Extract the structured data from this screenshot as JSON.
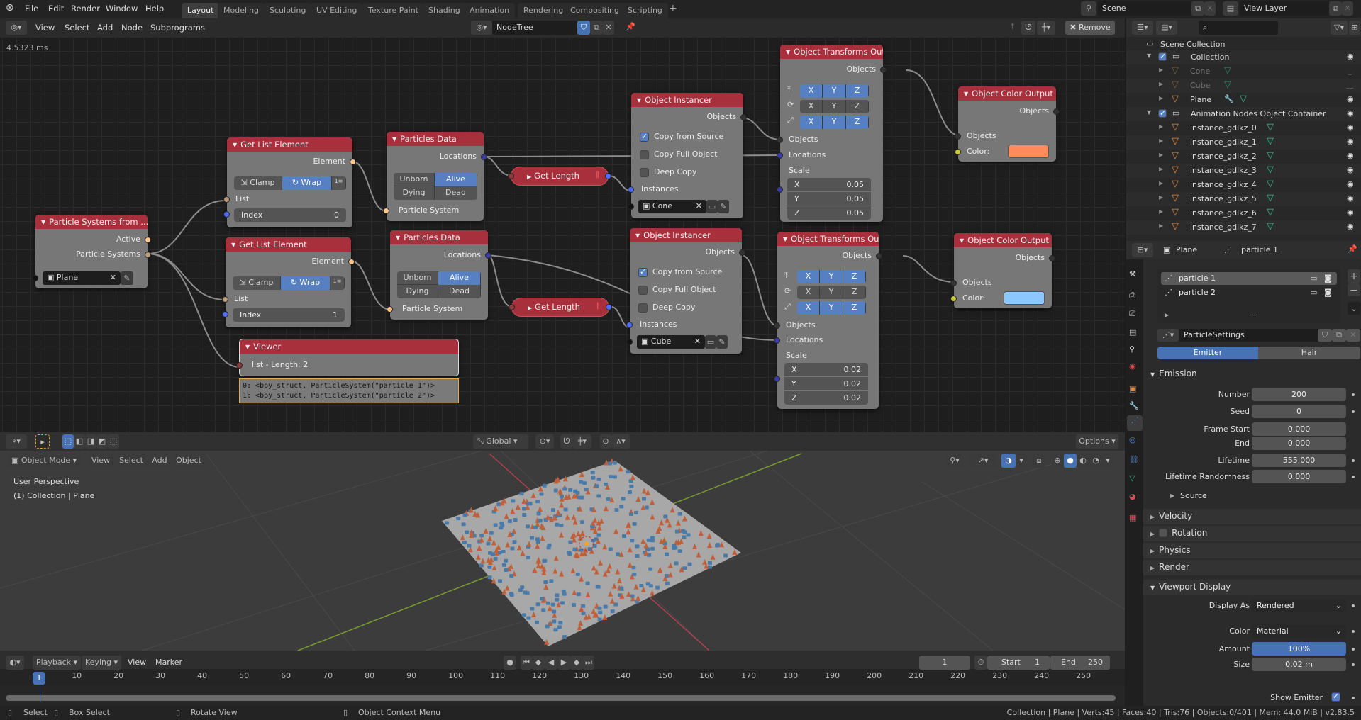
{
  "topbar": {
    "menus": [
      "File",
      "Edit",
      "Render",
      "Window",
      "Help"
    ],
    "workspaces": [
      "Layout",
      "Modeling",
      "Sculpting",
      "UV Editing",
      "Texture Paint",
      "Shading",
      "Animation",
      "Rendering",
      "Compositing",
      "Scripting"
    ],
    "active_workspace": "Layout",
    "scene": "Scene",
    "view_layer": "View Layer"
  },
  "node_editor": {
    "menus": [
      "View",
      "Select",
      "Add",
      "Node",
      "Subprograms"
    ],
    "tree_name": "NodeTree",
    "remove_label": "Remove",
    "timing": "4.5323 ms",
    "nodes": {
      "ps_from": {
        "title": "Particle Systems from ...",
        "out1": "Active",
        "out2": "Particle Systems",
        "object": "Plane"
      },
      "gle1": {
        "title": "Get List Element",
        "out": "Element",
        "clamp": "Clamp",
        "wrap": "Wrap",
        "in_list": "List",
        "index_label": "Index",
        "index": "0"
      },
      "gle2": {
        "title": "Get List Element",
        "out": "Element",
        "clamp": "Clamp",
        "wrap": "Wrap",
        "in_list": "List",
        "index_label": "Index",
        "index": "1"
      },
      "pd1": {
        "title": "Particles Data",
        "out": "Locations",
        "states": [
          "Unborn",
          "Alive",
          "Dying",
          "Dead"
        ],
        "active_state": "Alive",
        "in": "Particle System"
      },
      "pd2": {
        "title": "Particles Data",
        "out": "Locations",
        "states": [
          "Unborn",
          "Alive",
          "Dying",
          "Dead"
        ],
        "active_state": "Alive",
        "in": "Particle System"
      },
      "gl1": {
        "title": "Get Length"
      },
      "gl2": {
        "title": "Get Length"
      },
      "oi1": {
        "title": "Object Instancer",
        "out": "Objects",
        "copy_source": "Copy from Source",
        "copy_full": "Copy Full Object",
        "deep_copy": "Deep Copy",
        "copy_source_checked": true,
        "copy_full_checked": false,
        "deep_copy_checked": false,
        "instances": "Instances",
        "object": "Cone"
      },
      "oi2": {
        "title": "Object Instancer",
        "out": "Objects",
        "copy_source": "Copy from Source",
        "copy_full": "Copy Full Object",
        "deep_copy": "Deep Copy",
        "copy_source_checked": true,
        "copy_full_checked": false,
        "deep_copy_checked": false,
        "instances": "Instances",
        "object": "Cube"
      },
      "oto1": {
        "title": "Object Transforms Output",
        "out": "Objects",
        "axes": [
          "X",
          "Y",
          "Z"
        ],
        "in_objects": "Objects",
        "in_locations": "Locations",
        "scale_label": "Scale",
        "scale": {
          "X": "0.05",
          "Y": "0.05",
          "Z": "0.05"
        }
      },
      "oto2": {
        "title": "Object Transforms Output",
        "out": "Objects",
        "axes": [
          "X",
          "Y",
          "Z"
        ],
        "in_objects": "Objects",
        "in_locations": "Locations",
        "scale_label": "Scale",
        "scale": {
          "X": "0.02",
          "Y": "0.02",
          "Z": "0.02"
        }
      },
      "oco1": {
        "title": "Object Color Output",
        "out": "Objects",
        "in_objects": "Objects",
        "color_label": "Color:",
        "color": "#ff8a5c"
      },
      "oco2": {
        "title": "Object Color Output",
        "out": "Objects",
        "in_objects": "Objects",
        "color_label": "Color:",
        "color": "#8cc8ff"
      },
      "viewer": {
        "title": "Viewer",
        "text": "list - Length: 2",
        "lines": [
          "0: <bpy_struct, ParticleSystem(\"particle 1\")>",
          "1: <bpy_struct, ParticleSystem(\"particle 2\")>"
        ]
      }
    }
  },
  "viewport": {
    "mode": "Object Mode",
    "menus": [
      "View",
      "Select",
      "Add",
      "Object"
    ],
    "orientation": "Global",
    "options": "Options",
    "perspective": "User Perspective",
    "context": "(1) Collection | Plane"
  },
  "timeline": {
    "menus": [
      "Playback",
      "Keying",
      "View",
      "Marker"
    ],
    "current_frame": "1",
    "start_label": "Start",
    "start": "1",
    "end_label": "End",
    "end": "250",
    "ticks": [
      "10",
      "20",
      "30",
      "40",
      "50",
      "60",
      "70",
      "80",
      "90",
      "100",
      "110",
      "120",
      "130",
      "140",
      "150",
      "160",
      "170",
      "180",
      "190",
      "200",
      "210",
      "220",
      "230",
      "240",
      "250"
    ]
  },
  "statusbar": {
    "hints": [
      "Select",
      "Box Select",
      "Rotate View",
      "Object Context Menu"
    ],
    "stats": "Collection | Plane | Verts:45 | Faces:40 | Tris:76 | Objects:0/401 | Mem: 44.0 MiB | v2.83.5"
  },
  "outliner": {
    "root": "Scene Collection",
    "items": [
      {
        "label": "Collection",
        "type": "collection",
        "depth": 0,
        "visible": true
      },
      {
        "label": "Cone",
        "type": "object",
        "depth": 1,
        "visible": false,
        "dim": true
      },
      {
        "label": "Cube",
        "type": "object",
        "depth": 1,
        "visible": false,
        "dim": true
      },
      {
        "label": "Plane",
        "type": "object",
        "depth": 1,
        "visible": true,
        "modifier": true
      },
      {
        "label": "Animation Nodes Object Container",
        "type": "collection",
        "depth": 0,
        "visible": true
      },
      {
        "label": "instance_gdlkz_0",
        "type": "object",
        "depth": 1,
        "visible": true
      },
      {
        "label": "instance_gdlkz_1",
        "type": "object",
        "depth": 1,
        "visible": true
      },
      {
        "label": "instance_gdlkz_2",
        "type": "object",
        "depth": 1,
        "visible": true
      },
      {
        "label": "instance_gdlkz_3",
        "type": "object",
        "depth": 1,
        "visible": true
      },
      {
        "label": "instance_gdlkz_4",
        "type": "object",
        "depth": 1,
        "visible": true
      },
      {
        "label": "instance_gdlkz_5",
        "type": "object",
        "depth": 1,
        "visible": true
      },
      {
        "label": "instance_gdlkz_6",
        "type": "object",
        "depth": 1,
        "visible": true
      },
      {
        "label": "instance_gdlkz_7",
        "type": "object",
        "depth": 1,
        "visible": true
      }
    ]
  },
  "properties": {
    "breadcrumb_object": "Plane",
    "breadcrumb_particle": "particle 1",
    "systems": [
      "particle 1",
      "particle 2"
    ],
    "active_system": "particle 1",
    "settings_name": "ParticleSettings",
    "type_tabs": [
      "Emitter",
      "Hair"
    ],
    "active_type": "Emitter",
    "emission": {
      "title": "Emission",
      "fields": [
        {
          "label": "Number",
          "value": "200"
        },
        {
          "label": "Seed",
          "value": "0"
        },
        {
          "label": "Frame Start",
          "value": "0.000"
        },
        {
          "label": "End",
          "value": "0.000"
        },
        {
          "label": "Lifetime",
          "value": "555.000"
        },
        {
          "label": "Lifetime Randomness",
          "value": "0.000"
        }
      ],
      "source": "Source"
    },
    "collapsed_panels": [
      "Velocity",
      "Rotation",
      "Physics",
      "Render"
    ],
    "viewport_display": {
      "title": "Viewport Display",
      "display_as_label": "Display As",
      "display_as": "Rendered",
      "color_label": "Color",
      "color": "Material",
      "amount_label": "Amount",
      "amount": "100%",
      "size_label": "Size",
      "size": "0.02 m",
      "show_emitter_label": "Show Emitter",
      "show_emitter": true
    }
  }
}
